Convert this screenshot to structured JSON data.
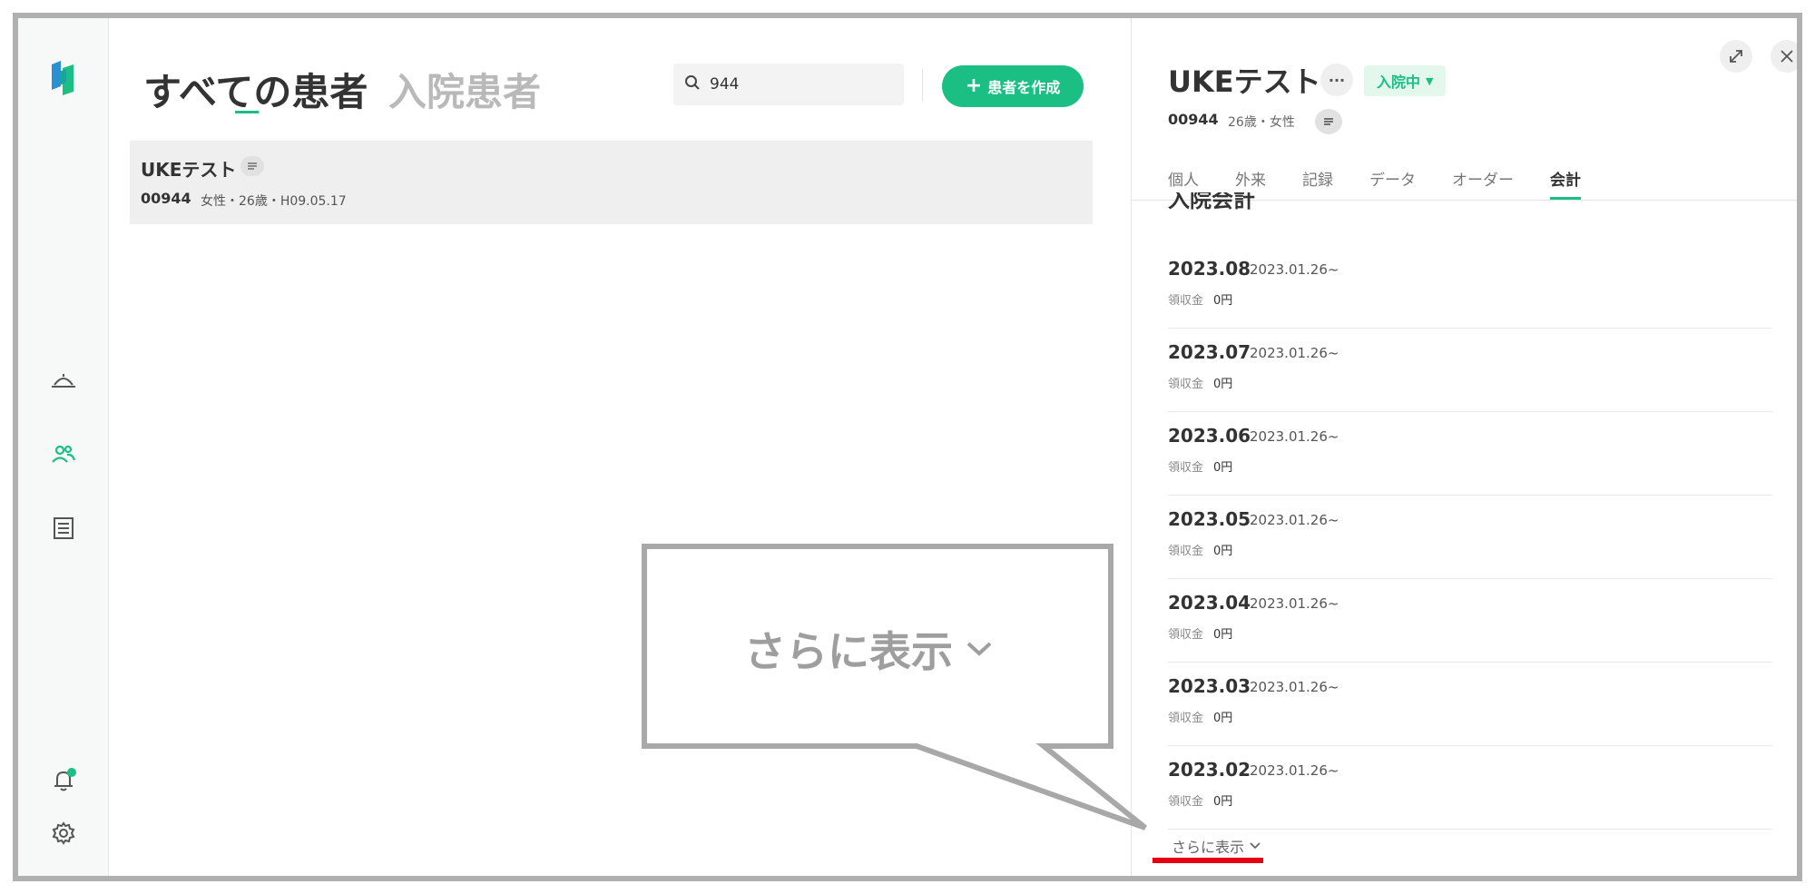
{
  "sidebar": {
    "icons": [
      "logo-icon",
      "home-icon",
      "users-icon",
      "list-icon",
      "bell-icon",
      "gear-icon"
    ]
  },
  "left": {
    "title": "すべての患者",
    "subtitle": "入院患者",
    "search": {
      "value": "944"
    },
    "create_button": "患者を作成",
    "patient": {
      "name": "UKEテスト",
      "id": "00944",
      "info": "女性・26歳・H09.05.17"
    }
  },
  "right": {
    "name": "UKEテスト",
    "more_label": "···",
    "status": "入院中",
    "id": "00944",
    "info": "26歳・女性",
    "tabs": [
      "個人",
      "外来",
      "記録",
      "データ",
      "オーダー",
      "会計"
    ],
    "section_title": "入院会計",
    "months": [
      {
        "month": "2023.08",
        "range": "2023.01.26~",
        "label": "領収金",
        "value": "0円"
      },
      {
        "month": "2023.07",
        "range": "2023.01.26~",
        "label": "領収金",
        "value": "0円"
      },
      {
        "month": "2023.06",
        "range": "2023.01.26~",
        "label": "領収金",
        "value": "0円"
      },
      {
        "month": "2023.05",
        "range": "2023.01.26~",
        "label": "領収金",
        "value": "0円"
      },
      {
        "month": "2023.04",
        "range": "2023.01.26~",
        "label": "領収金",
        "value": "0円"
      },
      {
        "month": "2023.03",
        "range": "2023.01.26~",
        "label": "領収金",
        "value": "0円"
      },
      {
        "month": "2023.02",
        "range": "2023.01.26~",
        "label": "領収金",
        "value": "0円"
      }
    ],
    "show_more": "さらに表示"
  },
  "callout": {
    "text": "さらに表示"
  },
  "colors": {
    "accent": "#1bbf83",
    "highlight": "#e60012",
    "frame": "#b0b0b0"
  }
}
